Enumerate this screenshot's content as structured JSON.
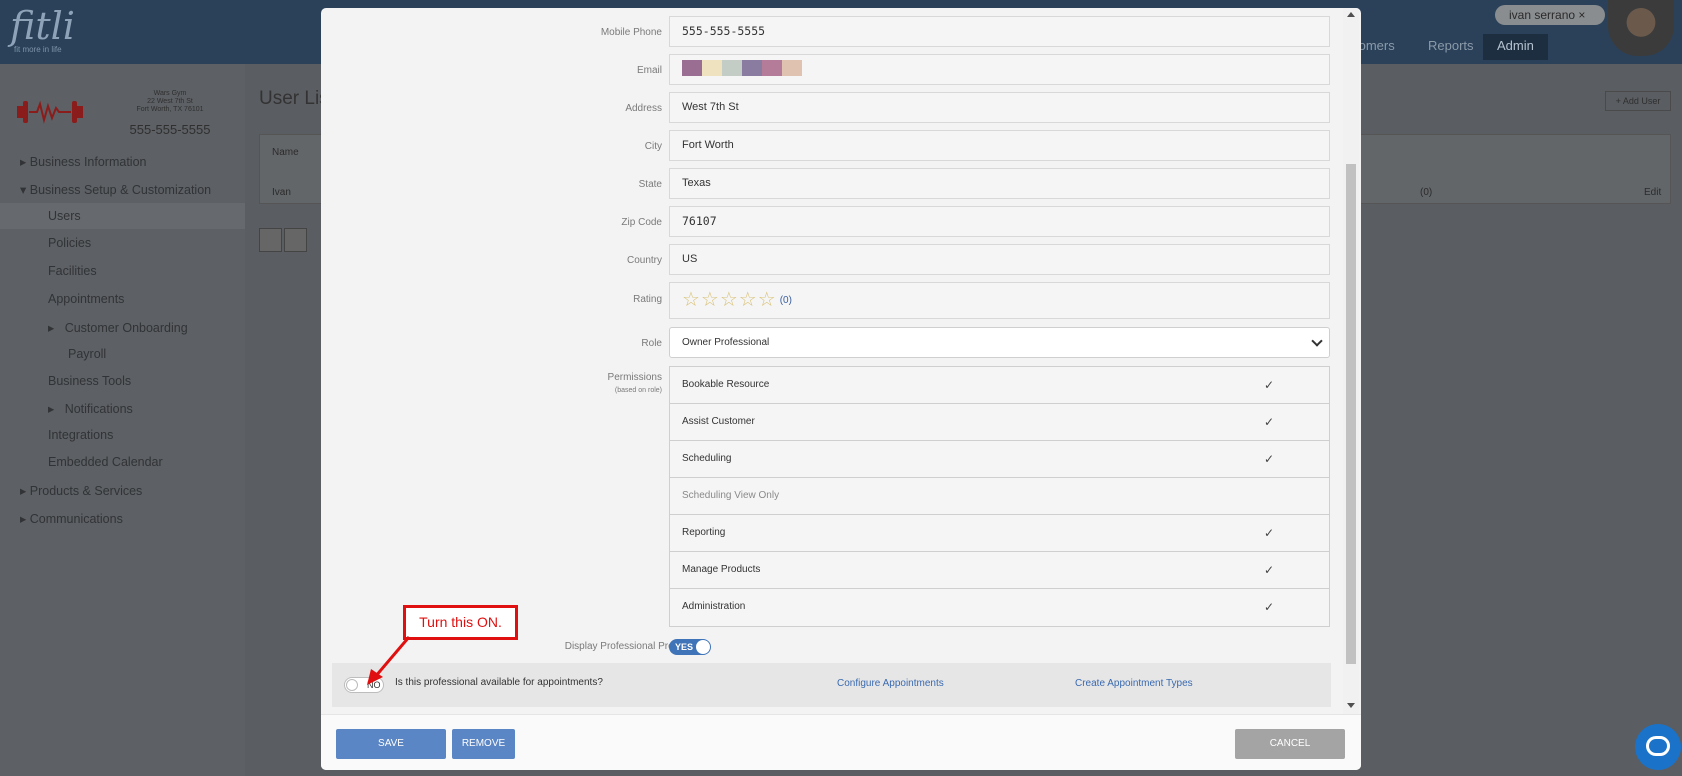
{
  "app": {
    "logo": "fitli",
    "logo_tagline": "fit more in life",
    "user_name": "ivan serrano",
    "nav": {
      "customers": "tomers",
      "reports": "Reports",
      "admin": "Admin"
    }
  },
  "business": {
    "name": "Wars Gym",
    "street": "22 West 7th St",
    "city_line": "Fort Worth, TX 76101",
    "phone": "555-555-5555"
  },
  "sidebar": {
    "items": [
      {
        "label": "Business Information"
      },
      {
        "label": "Business Setup & Customization"
      },
      {
        "label": "Users"
      },
      {
        "label": "Policies"
      },
      {
        "label": "Facilities"
      },
      {
        "label": "Appointments"
      },
      {
        "label": "Customer Onboarding"
      },
      {
        "label": "Payroll"
      },
      {
        "label": "Business Tools"
      },
      {
        "label": "Notifications"
      },
      {
        "label": "Integrations"
      },
      {
        "label": "Embedded Calendar"
      },
      {
        "label": "Products & Services"
      },
      {
        "label": "Communications"
      }
    ]
  },
  "main": {
    "title": "User List",
    "add_user": "+ Add User",
    "col_name": "Name",
    "row_name": "Ivan",
    "row_count": "(0)",
    "row_edit": "Edit"
  },
  "form": {
    "mobile_phone": {
      "label": "Mobile Phone",
      "value": "555-555-5555"
    },
    "email": {
      "label": "Email",
      "swatches": [
        "#9a6e92",
        "#efe2bf",
        "#c4ccc6",
        "#8a7ba0",
        "#b47c99",
        "#e0c2b0"
      ]
    },
    "address": {
      "label": "Address",
      "value": "West 7th St"
    },
    "city": {
      "label": "City",
      "value": "Fort Worth"
    },
    "state": {
      "label": "State",
      "value": "Texas"
    },
    "zip": {
      "label": "Zip Code",
      "value": "76107"
    },
    "country": {
      "label": "Country",
      "value": "US"
    },
    "rating": {
      "label": "Rating",
      "stars": "☆☆☆☆☆",
      "count": "(0)"
    },
    "role": {
      "label": "Role",
      "value": "Owner Professional"
    },
    "permissions": {
      "label": "Permissions",
      "sublabel": "(based on role)",
      "items": [
        {
          "label": "Bookable Resource",
          "checked": "✓"
        },
        {
          "label": "Assist Customer",
          "checked": "✓"
        },
        {
          "label": "Scheduling",
          "checked": "✓"
        },
        {
          "label": "Scheduling View Only",
          "checked": ""
        },
        {
          "label": "Reporting",
          "checked": "✓"
        },
        {
          "label": "Manage Products",
          "checked": "✓"
        },
        {
          "label": "Administration",
          "checked": "✓"
        }
      ]
    },
    "display_profile": {
      "label": "Display Professional Profile?",
      "toggle": "YES"
    },
    "availability": {
      "toggle": "NO",
      "question": "Is this professional available for appointments?",
      "configure_link": "Configure Appointments",
      "types_link": "Create Appointment Types"
    }
  },
  "callout": {
    "text": "Turn this ON.",
    "color": "#e01010"
  },
  "footer": {
    "save": "SAVE",
    "remove": "REMOVE",
    "cancel": "CANCEL"
  }
}
